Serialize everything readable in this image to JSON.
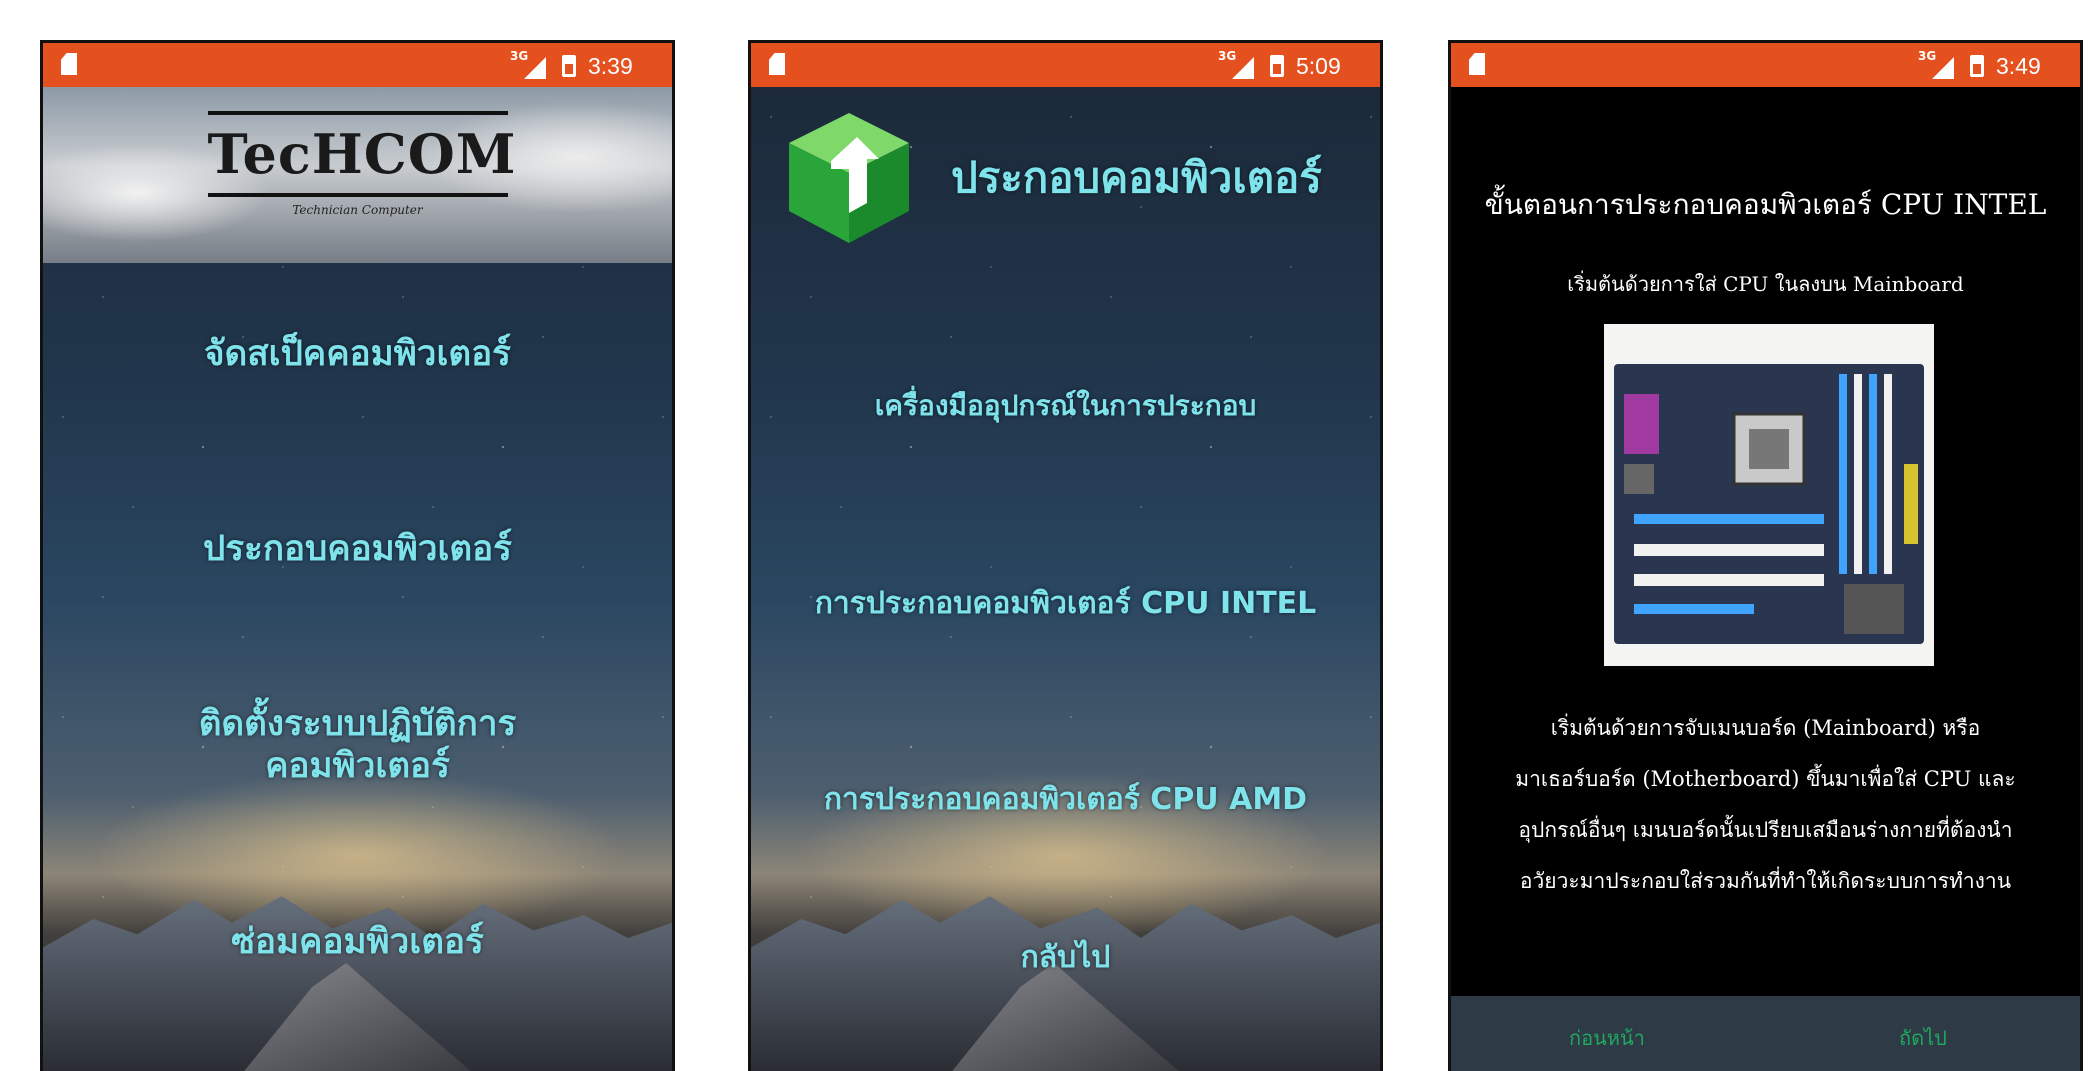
{
  "screen1": {
    "status": {
      "time": "3:39",
      "network": "3G"
    },
    "logo": {
      "title": "TecHCOM",
      "subtitle": "Technician Computer"
    },
    "menu": [
      "จัดสเป็คคอมพิวเตอร์",
      "ประกอบคอมพิวเตอร์",
      "ติดตั้งระบบปฏิบัติการ",
      "คอมพิวเตอร์",
      "ซ่อมคอมพิวเตอร์"
    ]
  },
  "screen2": {
    "status": {
      "time": "5:09",
      "network": "3G"
    },
    "title": "ประกอบคอมพิวเตอร์",
    "menu": [
      "เครื่องมืออุปกรณ์ในการประกอบ",
      "การประกอบคอมพิวเตอร์ CPU INTEL",
      "การประกอบคอมพิวเตอร์ CPU AMD",
      "กลับไป"
    ]
  },
  "screen3": {
    "status": {
      "time": "3:49",
      "network": "3G"
    },
    "heading": "ขั้นตอนการประกอบคอมพิวเตอร์ CPU INTEL",
    "subheading": "เริ่มต้นด้วยการใส่ CPU ในลงบน Mainboard",
    "body": [
      "เริ่มต้นด้วยการจับเมนบอร์ด (Mainboard) หรือ",
      "มาเธอร์บอร์ด (Motherboard) ขึ้นมาเพื่อใส่ CPU และ",
      "อุปกรณ์อื่นๆ เมนบอร์ดนั้นเปรียบเสมือนร่างกายที่ต้องนำ",
      "อวัยวะมาประกอบใส่รวมกันที่ทำให้เกิดระบบการทำงาน"
    ],
    "nav": {
      "prev": "ก่อนหน้า",
      "next": "ถัดไป"
    }
  },
  "colors": {
    "statusbar": "#e5501f",
    "accent_text": "#7fe3ec",
    "nav_text": "#1fa85e",
    "footer": "#2e3a45"
  }
}
